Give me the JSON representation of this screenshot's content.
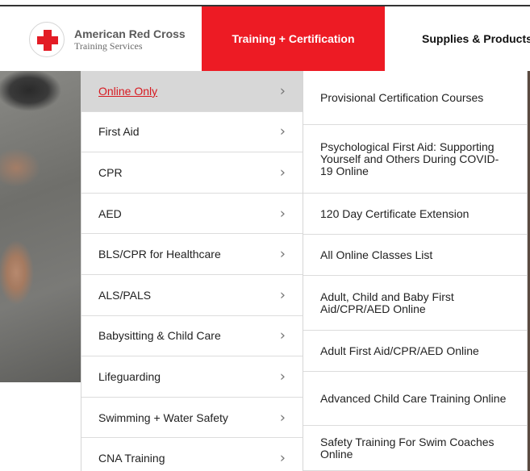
{
  "brand": {
    "title": "American Red Cross",
    "subtitle": "Training Services",
    "accent": "#ed1b24"
  },
  "nav": {
    "training": "Training + Certification",
    "supplies": "Supplies & Products"
  },
  "menu": {
    "categories": [
      {
        "label": "Online Only",
        "active": true
      },
      {
        "label": "First Aid"
      },
      {
        "label": "CPR"
      },
      {
        "label": "AED"
      },
      {
        "label": "BLS/CPR for Healthcare"
      },
      {
        "label": "ALS/PALS"
      },
      {
        "label": "Babysitting & Child Care"
      },
      {
        "label": "Lifeguarding"
      },
      {
        "label": "Swimming + Water Safety"
      },
      {
        "label": "CNA Training"
      }
    ],
    "chevron": "›",
    "sub_items": [
      {
        "label": "Provisional Certification Courses"
      },
      {
        "label": "Psychological First Aid: Supporting Yourself and Others During COVID-19 Online"
      },
      {
        "label": "120 Day Certificate Extension"
      },
      {
        "label": "All Online Classes List"
      },
      {
        "label": "Adult, Child and Baby First Aid/CPR/AED Online"
      },
      {
        "label": "Adult First Aid/CPR/AED Online"
      },
      {
        "label": "Advanced Child Care Training Online"
      },
      {
        "label": "Safety Training For Swim Coaches Online"
      }
    ]
  }
}
